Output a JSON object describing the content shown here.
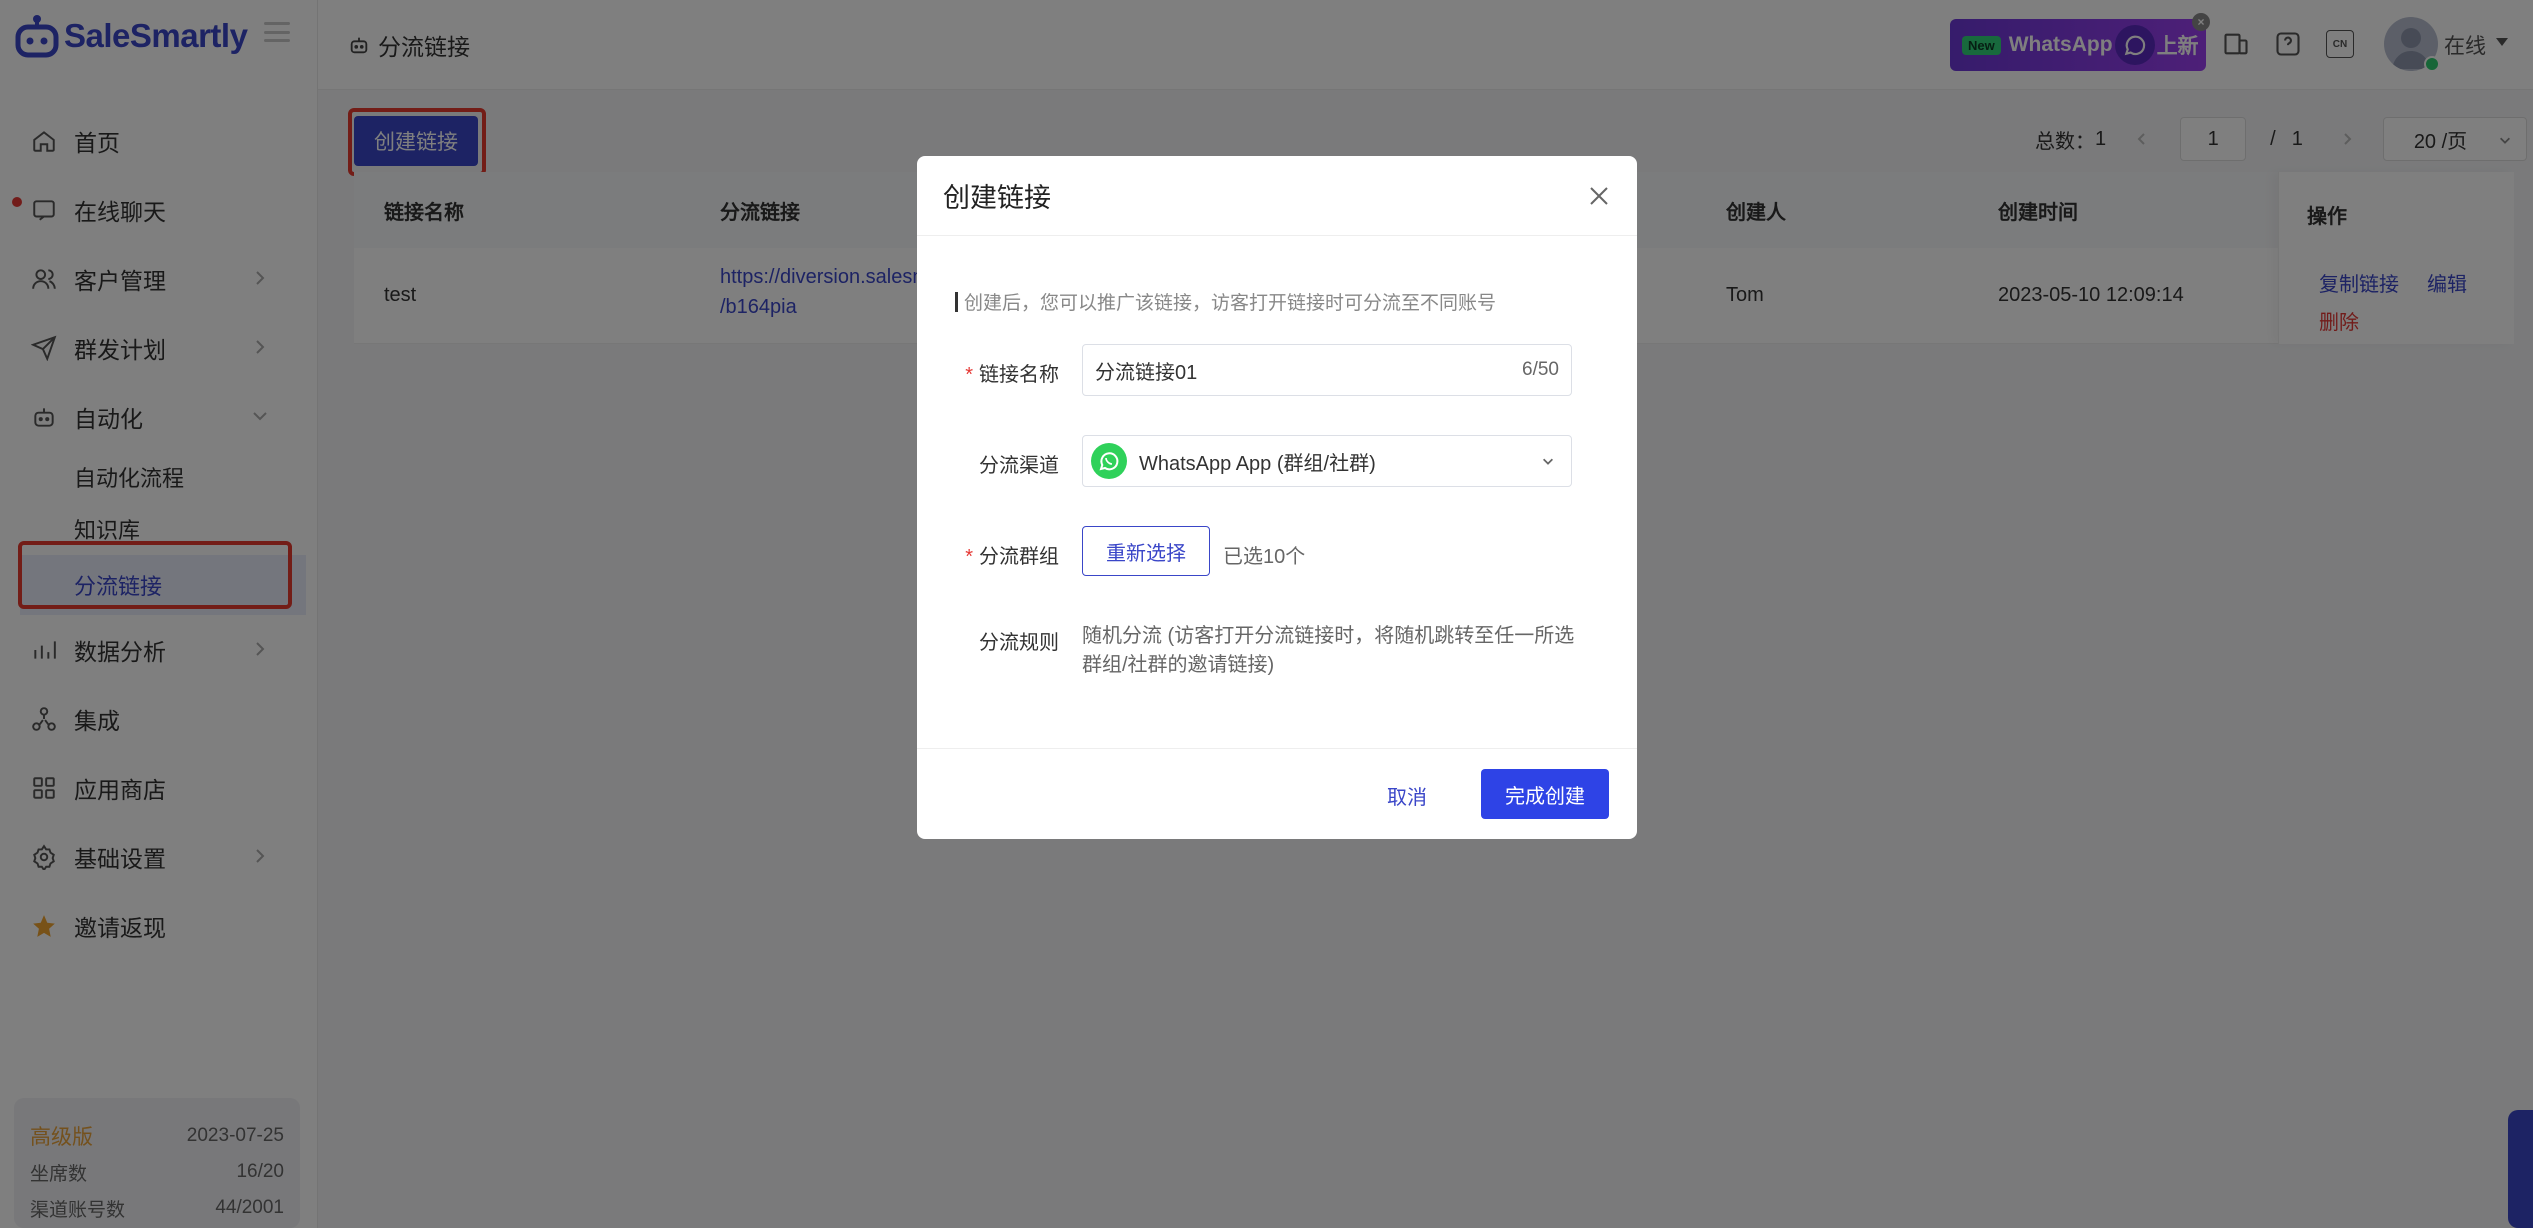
{
  "app": {
    "name": "SaleSmartly"
  },
  "sidebar": {
    "items": [
      {
        "label": "首页",
        "icon": "home-icon"
      },
      {
        "label": "在线聊天",
        "icon": "chat-icon"
      },
      {
        "label": "客户管理",
        "icon": "users-icon"
      },
      {
        "label": "群发计划",
        "icon": "send-icon"
      },
      {
        "label": "自动化",
        "icon": "robot-icon"
      },
      {
        "label": "数据分析",
        "icon": "chart-icon"
      },
      {
        "label": "集成",
        "icon": "integration-icon"
      },
      {
        "label": "应用商店",
        "icon": "apps-icon"
      },
      {
        "label": "基础设置",
        "icon": "gear-icon"
      },
      {
        "label": "邀请返现",
        "icon": "star-icon"
      }
    ],
    "automation_sub": [
      "自动化流程",
      "知识库",
      "分流链接"
    ],
    "plan": {
      "name": "高级版",
      "expiry": "2023-07-25",
      "seats_label": "坐席数",
      "seats_value": "16/20",
      "channels_label": "渠道账号数",
      "channels_value": "44/2001"
    }
  },
  "topbar": {
    "breadcrumb": "分流链接",
    "banner": {
      "badge": "New",
      "text": "WhatsApp",
      "suffix": "上新"
    },
    "status": "在线",
    "lang": "CN"
  },
  "toolbar": {
    "create_label": "创建链接"
  },
  "pagination": {
    "total_label": "总数：",
    "total": "1",
    "page": "1",
    "separator": "/",
    "pages": "1",
    "page_size": "20 /页"
  },
  "table": {
    "columns": [
      "链接名称",
      "分流链接",
      "创建人",
      "创建时间",
      "操作"
    ],
    "rows": [
      {
        "name": "test",
        "link_line1": "https://diversion.salesm",
        "link_line2": "/b164pia",
        "creator": "Tom",
        "created": "2023-05-10 12:09:14",
        "op_copy": "复制链接",
        "op_edit": "编辑",
        "op_delete": "删除"
      }
    ]
  },
  "modal": {
    "title": "创建链接",
    "tip": "创建后，您可以推广该链接，访客打开链接时可分流至不同账号",
    "name_label": "链接名称",
    "name_value": "分流链接01",
    "name_count": "6/50",
    "channel_label": "分流渠道",
    "channel_value": "WhatsApp App (群组/社群)",
    "group_label": "分流群组",
    "group_button": "重新选择",
    "group_selected": "已选10个",
    "rule_label": "分流规则",
    "rule_text": "随机分流 (访客打开分流链接时，将随机跳转至任一所选群组/社群的邀请链接)",
    "cancel": "取消",
    "confirm": "完成创建"
  },
  "colors": {
    "primary": "#3a46c8",
    "highlight": "#e63a2e",
    "whatsapp": "#2fd15a"
  }
}
